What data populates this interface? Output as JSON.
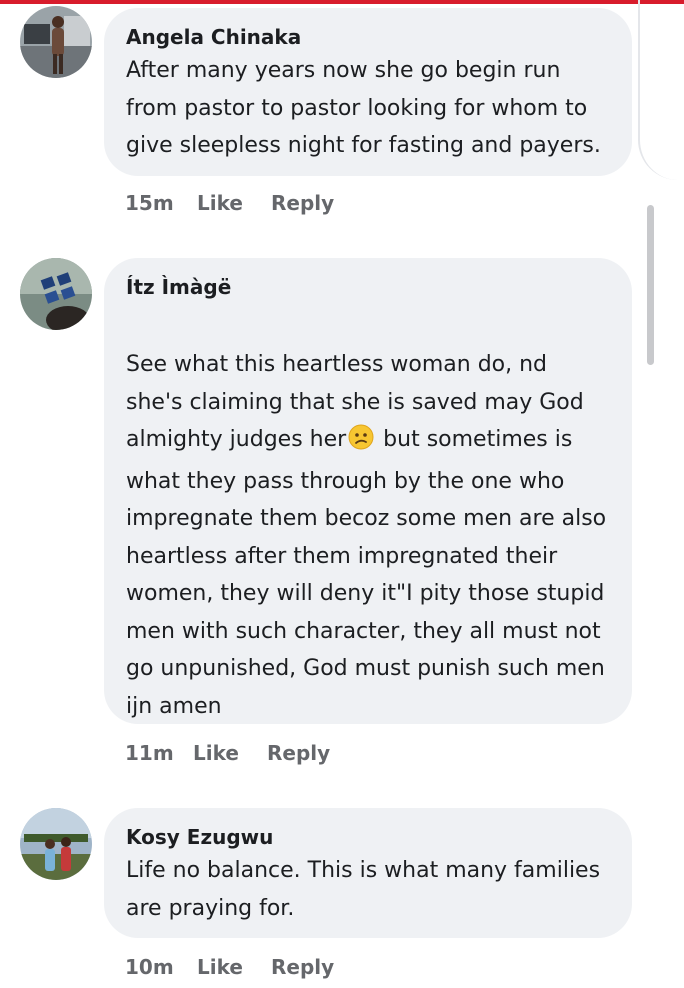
{
  "accent_color": "#d81c2c",
  "bubble_color": "#eff1f4",
  "meta_color": "#65676b",
  "comments": [
    {
      "author": "Angela Chinaka",
      "avatar": "avatar-photo",
      "text": "After many years now she go begin run from pastor to pastor looking for whom to give sleepless night for fasting and payers.",
      "time": "15m",
      "like": "Like",
      "reply": "Reply"
    },
    {
      "author": "Ítz Ìmàgë",
      "avatar": "avatar-photo",
      "text_before_emoji": "See what this heartless woman do, nd she's claiming that she is saved may God almighty judges her",
      "emoji": "confused-face-emoji",
      "text_after_emoji": " but sometimes is what they pass through by the one who impregnate them becoz some men are also heartless after them impregnated their women, they will deny it\"I pity those stupid men with such character, they all must not go unpunished, God must punish such men ijn amen",
      "time": "11m",
      "like": "Like",
      "reply": "Reply"
    },
    {
      "author": "Kosy Ezugwu",
      "avatar": "avatar-photo",
      "text": "Life no balance. This is what many families are praying for.",
      "time": "10m",
      "like": "Like",
      "reply": "Reply"
    }
  ]
}
